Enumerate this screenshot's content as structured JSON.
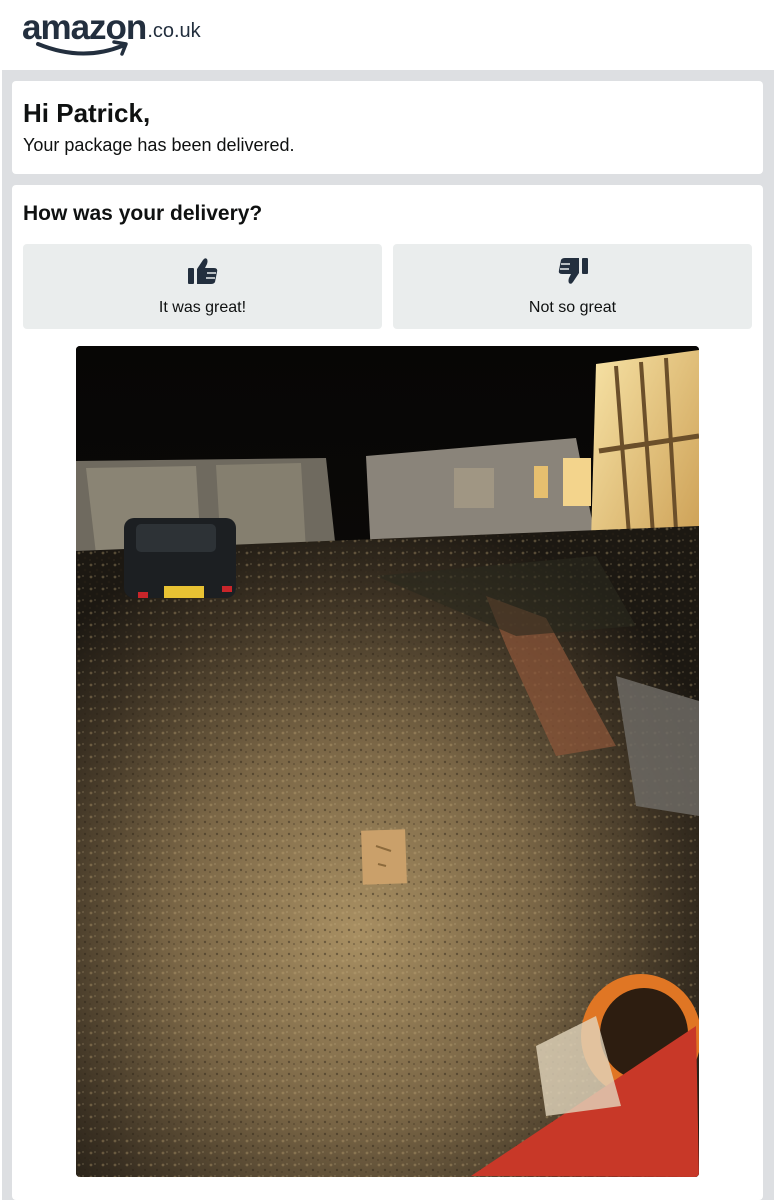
{
  "brand": {
    "logo_word": "amazon",
    "logo_tld": ".co.uk",
    "logo_color": "#232f3e",
    "smile_color": "#232f3e"
  },
  "greeting": {
    "title": "Hi Patrick,",
    "message": "Your package has been delivered."
  },
  "delivery_feedback": {
    "question": "How was your delivery?",
    "options": [
      {
        "label": "It was great!",
        "icon": "thumbs-up-icon"
      },
      {
        "label": "Not so great",
        "icon": "thumbs-down-icon"
      }
    ]
  },
  "colors": {
    "frame": "#dddfe2",
    "button_bg": "#eaeded",
    "text": "#0f1111",
    "icon": "#232f3e"
  },
  "photo": {
    "icon": "delivery-photo"
  }
}
